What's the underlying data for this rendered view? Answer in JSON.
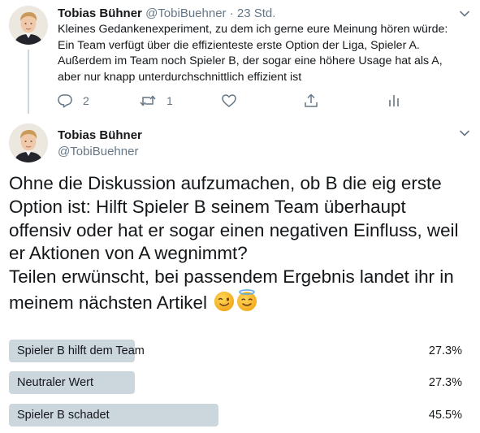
{
  "tweet1": {
    "name": "Tobias Bühner",
    "handle": "@TobiBuehner",
    "separator": "·",
    "time": "23 Std.",
    "lines": [
      "Kleines Gedankenexperiment, zu dem ich gerne eure Meinung hören würde:",
      "Ein Team verfügt über die effizienteste erste Option der Liga, Spieler A.",
      "Außerdem im Team noch Spieler B, der sogar eine höhere Usage hat als A,",
      "aber nur knapp unterdurchschnittlich effizient ist"
    ],
    "actions": {
      "reply_icon": "reply-icon",
      "reply_count": "2",
      "retweet_icon": "retweet-icon",
      "retweet_count": "1",
      "like_icon": "heart-icon",
      "share_icon": "share-icon",
      "analytics_icon": "analytics-icon"
    }
  },
  "tweet2": {
    "name": "Tobias Bühner",
    "handle": "@TobiBuehner",
    "lines": [
      "Ohne die Diskussion aufzumachen, ob B die eig erste",
      "Option ist: Hilft Spieler B seinem Team überhaupt",
      "offensiv oder hat er sogar einen negativen Einfluss, weil",
      "er Aktionen von A wegnimmt?",
      "Teilen erwünscht, bei passendem Ergebnis landet ihr in",
      "meinem nächsten Artikel"
    ],
    "emojis": [
      "winking-face-emoji",
      "halo-face-emoji"
    ],
    "poll": [
      {
        "label": "Spieler B hilft dem Team",
        "percent_text": "27.3%",
        "percent": 27.3
      },
      {
        "label": "Neutraler Wert",
        "percent_text": "27.3%",
        "percent": 27.3
      },
      {
        "label": "Spieler B schadet",
        "percent_text": "45.5%",
        "percent": 45.5
      }
    ]
  },
  "colors": {
    "text": "#14171a",
    "secondary": "#657786",
    "poll_bar": "#ccd6dd",
    "thread_line": "#ccd6dd",
    "emoji_yellow": "#f5b21a"
  }
}
